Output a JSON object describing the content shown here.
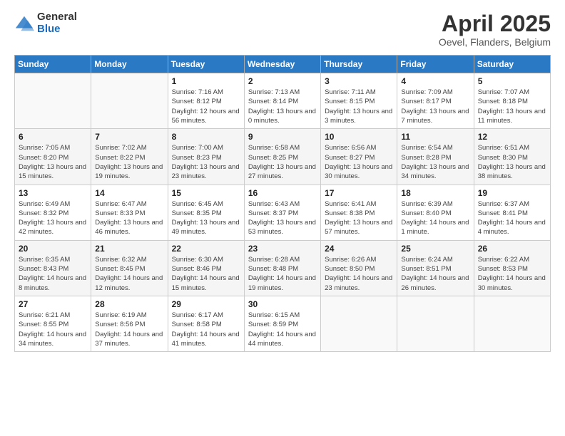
{
  "logo": {
    "general": "General",
    "blue": "Blue"
  },
  "title": "April 2025",
  "subtitle": "Oevel, Flanders, Belgium",
  "days_of_week": [
    "Sunday",
    "Monday",
    "Tuesday",
    "Wednesday",
    "Thursday",
    "Friday",
    "Saturday"
  ],
  "weeks": [
    [
      {
        "day": "",
        "sunrise": "",
        "sunset": "",
        "daylight": ""
      },
      {
        "day": "",
        "sunrise": "",
        "sunset": "",
        "daylight": ""
      },
      {
        "day": "1",
        "sunrise": "Sunrise: 7:16 AM",
        "sunset": "Sunset: 8:12 PM",
        "daylight": "Daylight: 12 hours and 56 minutes."
      },
      {
        "day": "2",
        "sunrise": "Sunrise: 7:13 AM",
        "sunset": "Sunset: 8:14 PM",
        "daylight": "Daylight: 13 hours and 0 minutes."
      },
      {
        "day": "3",
        "sunrise": "Sunrise: 7:11 AM",
        "sunset": "Sunset: 8:15 PM",
        "daylight": "Daylight: 13 hours and 3 minutes."
      },
      {
        "day": "4",
        "sunrise": "Sunrise: 7:09 AM",
        "sunset": "Sunset: 8:17 PM",
        "daylight": "Daylight: 13 hours and 7 minutes."
      },
      {
        "day": "5",
        "sunrise": "Sunrise: 7:07 AM",
        "sunset": "Sunset: 8:18 PM",
        "daylight": "Daylight: 13 hours and 11 minutes."
      }
    ],
    [
      {
        "day": "6",
        "sunrise": "Sunrise: 7:05 AM",
        "sunset": "Sunset: 8:20 PM",
        "daylight": "Daylight: 13 hours and 15 minutes."
      },
      {
        "day": "7",
        "sunrise": "Sunrise: 7:02 AM",
        "sunset": "Sunset: 8:22 PM",
        "daylight": "Daylight: 13 hours and 19 minutes."
      },
      {
        "day": "8",
        "sunrise": "Sunrise: 7:00 AM",
        "sunset": "Sunset: 8:23 PM",
        "daylight": "Daylight: 13 hours and 23 minutes."
      },
      {
        "day": "9",
        "sunrise": "Sunrise: 6:58 AM",
        "sunset": "Sunset: 8:25 PM",
        "daylight": "Daylight: 13 hours and 27 minutes."
      },
      {
        "day": "10",
        "sunrise": "Sunrise: 6:56 AM",
        "sunset": "Sunset: 8:27 PM",
        "daylight": "Daylight: 13 hours and 30 minutes."
      },
      {
        "day": "11",
        "sunrise": "Sunrise: 6:54 AM",
        "sunset": "Sunset: 8:28 PM",
        "daylight": "Daylight: 13 hours and 34 minutes."
      },
      {
        "day": "12",
        "sunrise": "Sunrise: 6:51 AM",
        "sunset": "Sunset: 8:30 PM",
        "daylight": "Daylight: 13 hours and 38 minutes."
      }
    ],
    [
      {
        "day": "13",
        "sunrise": "Sunrise: 6:49 AM",
        "sunset": "Sunset: 8:32 PM",
        "daylight": "Daylight: 13 hours and 42 minutes."
      },
      {
        "day": "14",
        "sunrise": "Sunrise: 6:47 AM",
        "sunset": "Sunset: 8:33 PM",
        "daylight": "Daylight: 13 hours and 46 minutes."
      },
      {
        "day": "15",
        "sunrise": "Sunrise: 6:45 AM",
        "sunset": "Sunset: 8:35 PM",
        "daylight": "Daylight: 13 hours and 49 minutes."
      },
      {
        "day": "16",
        "sunrise": "Sunrise: 6:43 AM",
        "sunset": "Sunset: 8:37 PM",
        "daylight": "Daylight: 13 hours and 53 minutes."
      },
      {
        "day": "17",
        "sunrise": "Sunrise: 6:41 AM",
        "sunset": "Sunset: 8:38 PM",
        "daylight": "Daylight: 13 hours and 57 minutes."
      },
      {
        "day": "18",
        "sunrise": "Sunrise: 6:39 AM",
        "sunset": "Sunset: 8:40 PM",
        "daylight": "Daylight: 14 hours and 1 minute."
      },
      {
        "day": "19",
        "sunrise": "Sunrise: 6:37 AM",
        "sunset": "Sunset: 8:41 PM",
        "daylight": "Daylight: 14 hours and 4 minutes."
      }
    ],
    [
      {
        "day": "20",
        "sunrise": "Sunrise: 6:35 AM",
        "sunset": "Sunset: 8:43 PM",
        "daylight": "Daylight: 14 hours and 8 minutes."
      },
      {
        "day": "21",
        "sunrise": "Sunrise: 6:32 AM",
        "sunset": "Sunset: 8:45 PM",
        "daylight": "Daylight: 14 hours and 12 minutes."
      },
      {
        "day": "22",
        "sunrise": "Sunrise: 6:30 AM",
        "sunset": "Sunset: 8:46 PM",
        "daylight": "Daylight: 14 hours and 15 minutes."
      },
      {
        "day": "23",
        "sunrise": "Sunrise: 6:28 AM",
        "sunset": "Sunset: 8:48 PM",
        "daylight": "Daylight: 14 hours and 19 minutes."
      },
      {
        "day": "24",
        "sunrise": "Sunrise: 6:26 AM",
        "sunset": "Sunset: 8:50 PM",
        "daylight": "Daylight: 14 hours and 23 minutes."
      },
      {
        "day": "25",
        "sunrise": "Sunrise: 6:24 AM",
        "sunset": "Sunset: 8:51 PM",
        "daylight": "Daylight: 14 hours and 26 minutes."
      },
      {
        "day": "26",
        "sunrise": "Sunrise: 6:22 AM",
        "sunset": "Sunset: 8:53 PM",
        "daylight": "Daylight: 14 hours and 30 minutes."
      }
    ],
    [
      {
        "day": "27",
        "sunrise": "Sunrise: 6:21 AM",
        "sunset": "Sunset: 8:55 PM",
        "daylight": "Daylight: 14 hours and 34 minutes."
      },
      {
        "day": "28",
        "sunrise": "Sunrise: 6:19 AM",
        "sunset": "Sunset: 8:56 PM",
        "daylight": "Daylight: 14 hours and 37 minutes."
      },
      {
        "day": "29",
        "sunrise": "Sunrise: 6:17 AM",
        "sunset": "Sunset: 8:58 PM",
        "daylight": "Daylight: 14 hours and 41 minutes."
      },
      {
        "day": "30",
        "sunrise": "Sunrise: 6:15 AM",
        "sunset": "Sunset: 8:59 PM",
        "daylight": "Daylight: 14 hours and 44 minutes."
      },
      {
        "day": "",
        "sunrise": "",
        "sunset": "",
        "daylight": ""
      },
      {
        "day": "",
        "sunrise": "",
        "sunset": "",
        "daylight": ""
      },
      {
        "day": "",
        "sunrise": "",
        "sunset": "",
        "daylight": ""
      }
    ]
  ]
}
